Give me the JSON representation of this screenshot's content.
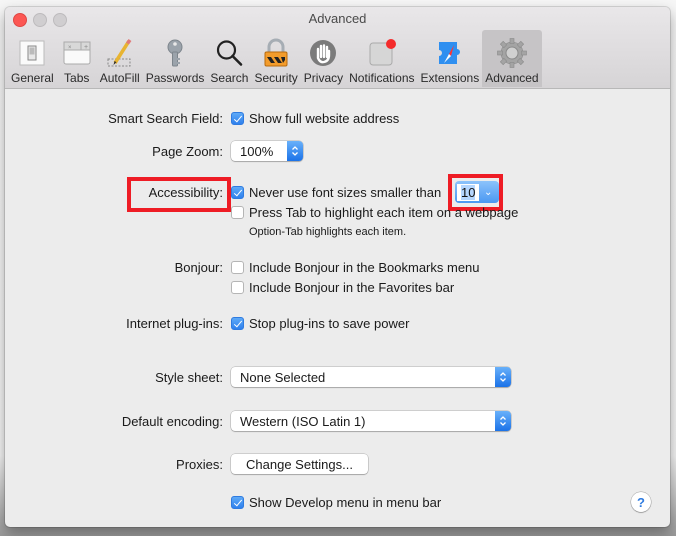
{
  "window": {
    "title": "Advanced"
  },
  "toolbar": {
    "items": [
      {
        "label": "General",
        "icon": "general-switch-icon",
        "active": false
      },
      {
        "label": "Tabs",
        "icon": "tabs-icon",
        "active": false
      },
      {
        "label": "AutoFill",
        "icon": "autofill-pencil-icon",
        "active": false
      },
      {
        "label": "Passwords",
        "icon": "key-icon",
        "active": false
      },
      {
        "label": "Search",
        "icon": "magnifier-icon",
        "active": false
      },
      {
        "label": "Security",
        "icon": "padlock-icon",
        "active": false
      },
      {
        "label": "Privacy",
        "icon": "hand-icon",
        "active": false
      },
      {
        "label": "Notifications",
        "icon": "notifications-badge-icon",
        "active": false
      },
      {
        "label": "Extensions",
        "icon": "extensions-puzzle-compass-icon",
        "active": false
      },
      {
        "label": "Advanced",
        "icon": "gear-icon",
        "active": true
      }
    ]
  },
  "settings": {
    "smart_search": {
      "label": "Smart Search Field:",
      "option": "Show full website address",
      "checked": true
    },
    "page_zoom": {
      "label": "Page Zoom:",
      "value": "100%"
    },
    "accessibility": {
      "label": "Accessibility:",
      "min_font": {
        "option": "Never use font sizes smaller than",
        "checked": true,
        "value": "10"
      },
      "tab_highlight": {
        "option": "Press Tab to highlight each item on a webpage",
        "checked": false
      },
      "note": "Option-Tab highlights each item."
    },
    "bonjour": {
      "label": "Bonjour:",
      "bookmarks": {
        "option": "Include Bonjour in the Bookmarks menu",
        "checked": false
      },
      "favorites": {
        "option": "Include Bonjour in the Favorites bar",
        "checked": false
      }
    },
    "plugins": {
      "label": "Internet plug-ins:",
      "option": "Stop plug-ins to save power",
      "checked": true
    },
    "style_sheet": {
      "label": "Style sheet:",
      "value": "None Selected"
    },
    "encoding": {
      "label": "Default encoding:",
      "value": "Western (ISO Latin 1)"
    },
    "proxies": {
      "label": "Proxies:",
      "button": "Change Settings..."
    },
    "develop": {
      "option": "Show Develop menu in menu bar",
      "checked": true
    },
    "help": "?"
  },
  "colors": {
    "highlight_box": "#ee1c25",
    "accent": "#2f80ed",
    "close": "#fc5753"
  }
}
